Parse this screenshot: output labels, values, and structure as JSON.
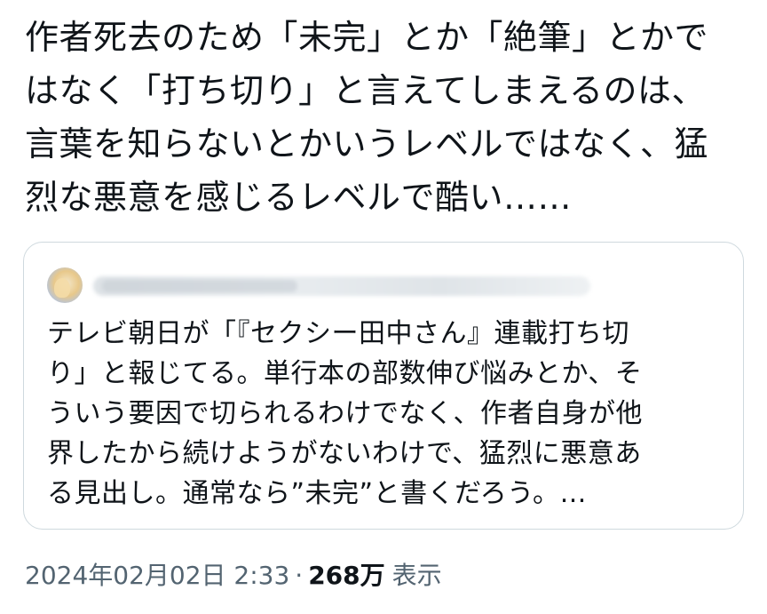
{
  "tweet": {
    "lines": [
      "作者死去のため「未完」とか「絶筆」とかで",
      "はなく「打ち切り」と言えてしまえるのは、",
      "言葉を知らないとかいうレベルではなく、猛",
      "烈な悪意を感じるレベルで酷い……"
    ]
  },
  "quote": {
    "lines": [
      "テレビ朝日が「『セクシー田中さん』連載打ち切",
      "り」と報じてる。単行本の部数伸び悩みとか、そ",
      "ういう要因で切られるわけでなく、作者自身が他",
      "界したから続けようがないわけで、猛烈に悪意あ",
      "る見出し。通常なら”未完”と書くだろう。…"
    ]
  },
  "meta": {
    "datetime": "2024年02月02日 2:33",
    "separator": "·",
    "views_count": "268万",
    "views_label": "表示"
  }
}
